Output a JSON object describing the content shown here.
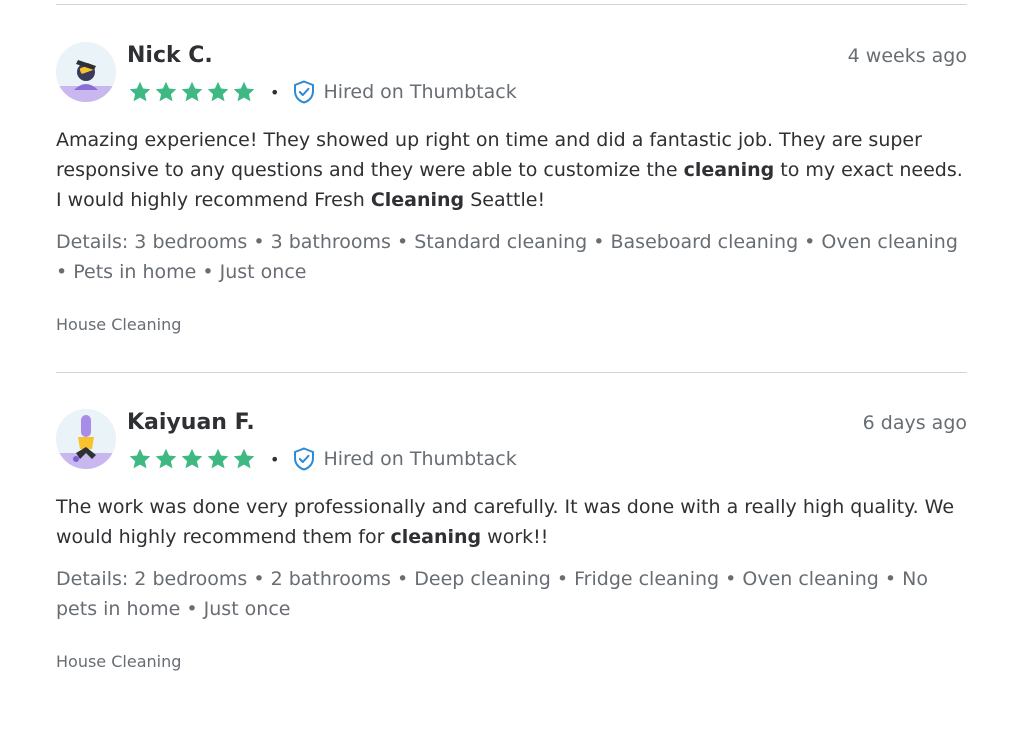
{
  "reviews": [
    {
      "name": "Nick C.",
      "date": "4 weeks ago",
      "rating": 5,
      "bullet": "•",
      "hired_label": "Hired on Thumbtack",
      "text_parts": [
        "Amazing experience! They showed up right on time and did a fantastic job. They are super responsive to any questions and they were able to customize the ",
        "cleaning",
        " to my exact needs. I would highly recommend Fresh ",
        "Cleaning",
        " Seattle!"
      ],
      "details": "Details: 3 bedrooms • 3 bathrooms • Standard cleaning • Baseboard cleaning • Oven cleaning • Pets in home • Just once",
      "category": "House Cleaning"
    },
    {
      "name": "Kaiyuan F.",
      "date": "6 days ago",
      "rating": 5,
      "bullet": "•",
      "hired_label": "Hired on Thumbtack",
      "text_parts": [
        "The work was done very professionally and carefully. It was done with a really high quality. We would highly recommend them for ",
        "cleaning",
        " work!!"
      ],
      "details": "Details: 2 bedrooms • 2 bathrooms • Deep cleaning • Fridge cleaning • Oven cleaning • No pets in home • Just once",
      "category": "House Cleaning"
    }
  ],
  "colors": {
    "star": "#3fb983",
    "shield": "#2d8ad5",
    "divider": "#d3d4d5",
    "muted_text": "#676d73",
    "main_text": "#2f3033"
  },
  "icons": {
    "star": "star-icon",
    "hired": "shield-check-icon"
  }
}
